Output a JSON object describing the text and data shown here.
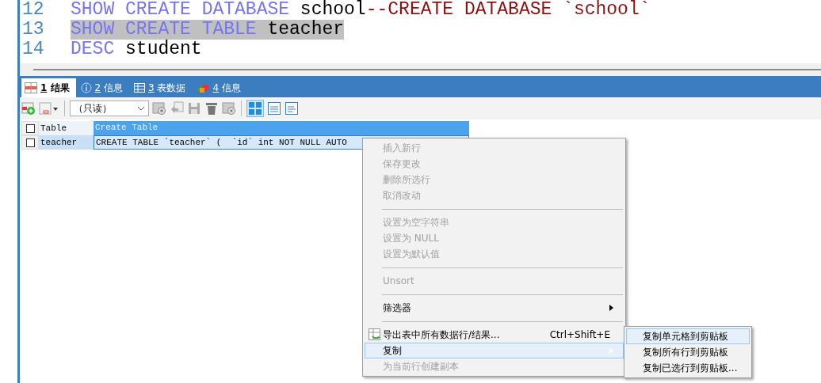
{
  "editor": {
    "lines": [
      {
        "number": "12",
        "selected": false,
        "tokens": [
          {
            "kind": "keyword",
            "text": "SHOW CREATE DATABASE"
          },
          {
            "kind": "ident",
            "text": " school"
          },
          {
            "kind": "comment",
            "text": "--CREATE DATABASE `school`"
          }
        ]
      },
      {
        "number": "13",
        "selected": true,
        "tokens": [
          {
            "kind": "keyword",
            "text": "SHOW CREATE TABLE"
          },
          {
            "kind": "ident",
            "text": " teacher"
          }
        ]
      },
      {
        "number": "14",
        "selected": false,
        "tokens": [
          {
            "kind": "keyword",
            "text": "DESC"
          },
          {
            "kind": "ident",
            "text": " student"
          }
        ]
      }
    ]
  },
  "tabs": [
    {
      "kind": "result",
      "number": "1",
      "label": "结果",
      "selected": true
    },
    {
      "kind": "info",
      "number": "2",
      "label": "信息",
      "selected": false
    },
    {
      "kind": "grid",
      "number": "3",
      "label": "表数据",
      "selected": false
    },
    {
      "kind": "shapes",
      "number": "4",
      "label": "信息",
      "selected": false
    }
  ],
  "toolbar": {
    "mode_dropdown": "（只读）"
  },
  "table": {
    "header_checked": false,
    "columns": [
      "Table",
      "Create Table"
    ],
    "rows": [
      {
        "checked": false,
        "selected": true,
        "cells": [
          "teacher",
          "CREATE TABLE `teacher` (  `id` int NOT NULL AUTO"
        ]
      }
    ]
  },
  "context_menu": {
    "items": [
      {
        "kind": "item",
        "label": "插入新行",
        "disabled": true,
        "selected": false
      },
      {
        "kind": "item",
        "label": "保存更改",
        "disabled": true,
        "selected": false
      },
      {
        "kind": "item",
        "label": "删除所选行",
        "disabled": true,
        "selected": false
      },
      {
        "kind": "item",
        "label": "取消改动",
        "disabled": true,
        "selected": false
      },
      {
        "kind": "separator"
      },
      {
        "kind": "item",
        "label": "设置为空字符串",
        "disabled": true,
        "selected": false
      },
      {
        "kind": "item",
        "label": "设置为 NULL",
        "disabled": true,
        "selected": false
      },
      {
        "kind": "item",
        "label": "设置为默认值",
        "disabled": true,
        "selected": false
      },
      {
        "kind": "separator"
      },
      {
        "kind": "item",
        "label": "Unsort",
        "disabled": true,
        "selected": false
      },
      {
        "kind": "separator"
      },
      {
        "kind": "submenu",
        "label": "筛选器",
        "disabled": false,
        "selected": false
      },
      {
        "kind": "separator"
      },
      {
        "kind": "export",
        "label": "导出表中所有数据行/结果...",
        "shortcut": "Ctrl+Shift+E",
        "disabled": false,
        "selected": false
      },
      {
        "kind": "submenu",
        "label": "复制",
        "disabled": false,
        "selected": true
      },
      {
        "kind": "item",
        "label": "为当前行创建副本",
        "disabled": true,
        "selected": false
      }
    ]
  },
  "submenu": {
    "items": [
      {
        "label": "复制单元格到剪贴板",
        "selected": true
      },
      {
        "label": "复制所有行到剪贴板",
        "selected": false
      },
      {
        "label": "复制已选行到剪贴板...",
        "selected": false
      }
    ]
  }
}
